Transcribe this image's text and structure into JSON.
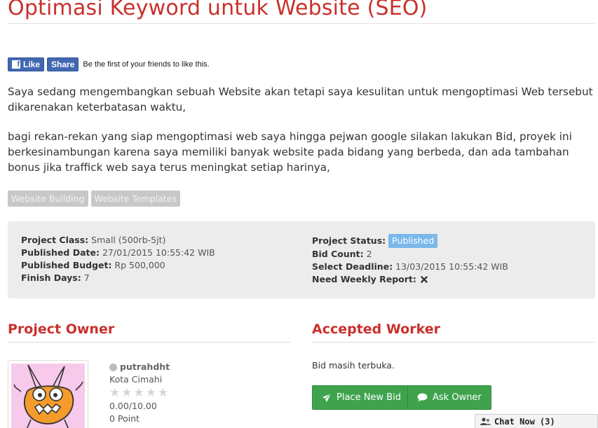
{
  "page": {
    "title": "Optimasi Keyword untuk Website (SEO)"
  },
  "facebook": {
    "like_label": "Like",
    "share_label": "Share",
    "social_text": "Be the first of your friends to like this."
  },
  "description": {
    "paragraph1": "Saya sedang mengembangkan sebuah Website akan tetapi saya kesulitan untuk mengoptimasi Web tersebut dikarenakan keterbatasan waktu,",
    "paragraph2": "bagi rekan-rekan yang siap mengoptimasi web saya hingga pejwan google silakan lakukan Bid, proyek ini berkesinambungan karena saya memiliki banyak website pada bidang yang berbeda, dan ada tambahan bonus jika traffick web saya terus meningkat setiap harinya,"
  },
  "tags": [
    "Website Building",
    "Website Templates"
  ],
  "project_info": {
    "class_label": "Project Class:",
    "class_value": "Small (500rb-5jt)",
    "published_date_label": "Published Date:",
    "published_date_value": "27/01/2015 10:55:42 WIB",
    "budget_label": "Published Budget:",
    "budget_value": "Rp 500,000",
    "finish_days_label": "Finish Days:",
    "finish_days_value": "7",
    "status_label": "Project Status:",
    "status_value": "Published",
    "bid_count_label": "Bid Count:",
    "bid_count_value": "2",
    "deadline_label": "Select Deadline:",
    "deadline_value": "13/03/2015 10:55:42 WIB",
    "weekly_report_label": "Need Weekly Report:",
    "weekly_report_icon": "times-icon"
  },
  "owner": {
    "section_title": "Project Owner",
    "username": "putrahdht",
    "city": "Kota Cimahi",
    "rating_stars": 0,
    "rating_max": 5,
    "rating_text": "0.00/10.00",
    "points": "0 Point"
  },
  "worker": {
    "section_title": "Accepted Worker",
    "status_text": "Bid masih terbuka.",
    "place_bid_label": "Place New Bid",
    "ask_owner_label": "Ask Owner"
  },
  "chat": {
    "label": "Chat Now (3)"
  },
  "colors": {
    "accent_red": "#c9302c",
    "facebook_blue": "#4267b2",
    "green_button": "#3fa34d",
    "status_badge": "#7ab8ea"
  }
}
